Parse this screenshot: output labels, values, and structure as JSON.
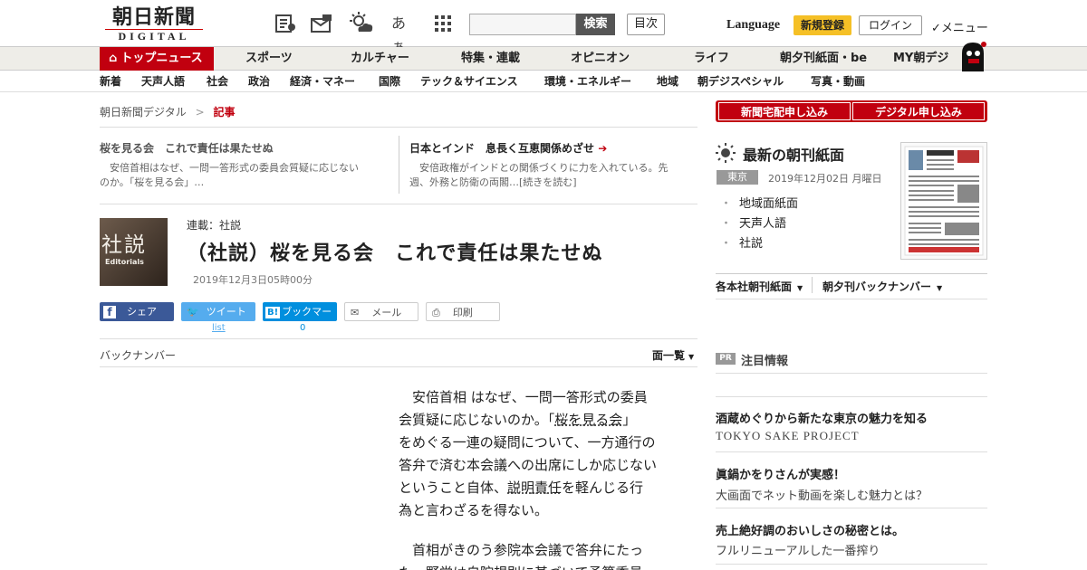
{
  "header": {
    "logo_jp": "朝日新聞",
    "logo_en": "DIGITAL",
    "kana_icon": "あぁ",
    "search_button": "検索",
    "toc_button": "目次",
    "language": "Language",
    "signup": "新規登録",
    "login": "ログイン",
    "menu": "✓メニュー"
  },
  "nav1": [
    "トップニュース",
    "スポーツ",
    "カルチャー",
    "特集・連載",
    "オピニオン",
    "ライフ",
    "朝夕刊紙面・be",
    "MY朝デジ"
  ],
  "nav2": [
    "新着",
    "天声人語",
    "社会",
    "政治",
    "経済・マネー",
    "国際",
    "テック＆サイエンス",
    "環境・エネルギー",
    "地域",
    "朝デジスペシャル",
    "写真・動画"
  ],
  "breadcrumb": {
    "home": "朝日新聞デジタル",
    "sep": ">",
    "current": "記事"
  },
  "prev": {
    "title": "桜を見る会　これで責任は果たせぬ",
    "text_1": "安倍首相はなぜ、一問一答形式の委員会質疑に応じない",
    "text_2": "のか。「桜を見る会」…"
  },
  "next": {
    "title": "日本とインド　息長く互恵関係めざせ",
    "text_1": "安倍政権がインドとの関係づくりに力を入れている。先",
    "text_2": "週、外務と防衛の両閣…[続きを読む]"
  },
  "article": {
    "img_kanji": "社説",
    "img_en": "Editorials",
    "series": "連載：社説",
    "title": "（社説）桜を見る会　これで責任は果たせぬ",
    "date": "2019年12月3日05時00分"
  },
  "share": {
    "facebook": "シェア",
    "twitter": "ツイート",
    "twitter_sub": "list",
    "hatena": "ブックマーク",
    "hatena_count": "0",
    "mail": "メール",
    "print": "印刷"
  },
  "backnumber": "バックナンバー",
  "ichiran": "面一覧",
  "body": {
    "p1_l1": "安倍首相 はなぜ、一問一答形式の委員",
    "p1_l2a": "会質疑に応じないのか。「",
    "p1_link1": "桜を見る会",
    "p1_l2b": "」",
    "p1_l3": "をめぐる一連の疑問について、一方通行の",
    "p1_l4": "答弁で済む本会議への出席にしか応じない",
    "p1_l5a": "ということ自体、",
    "p1_link2": "説明責任",
    "p1_l5b": "を軽んじる行",
    "p1_l6": "為と言わざるを得ない。",
    "p2_l1": "首相がきのう参院本会議で答弁にたっ",
    "p2_l2": "た。野党は自院規則に基づいて予算委員"
  },
  "right": {
    "btn1": "新聞宅配申し込み",
    "btn2": "デジタル申し込み",
    "latest_title": "最新の朝刊紙面",
    "region": "東京",
    "edition_date": "2019年12月02日 月曜日",
    "links": [
      "地域面紙面",
      "天声人語",
      "社説"
    ],
    "drop1": "各本社朝刊紙面",
    "drop2": "朝夕刊バックナンバー",
    "pr_badge": "PR",
    "attention": "注目情報",
    "pr_items": [
      {
        "title": "酒蔵めぐりから新たな東京の魅力を知る",
        "sub": "TOKYO SAKE PROJECT"
      },
      {
        "title": "眞鍋かをりさんが実感！",
        "sub": "大画面でネット動画を楽しむ魅力とは？"
      },
      {
        "title": "売上絶好調のおいしさの秘密とは。",
        "sub": "フルリニューアルした一番搾り"
      }
    ]
  },
  "colors": {
    "brand_red": "#c1000f",
    "accent_yellow": "#f5c026",
    "facebook": "#3b5998",
    "twitter": "#55acee",
    "hatena": "#008fde"
  }
}
